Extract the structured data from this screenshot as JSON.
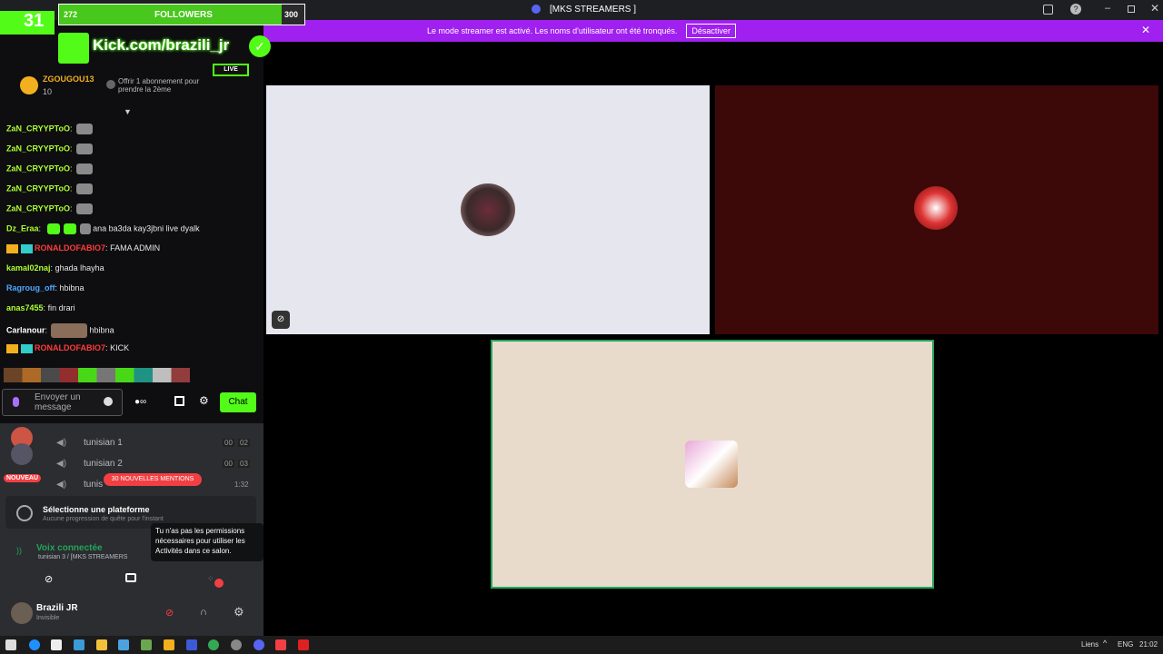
{
  "overlay": {
    "followers_count": "272",
    "followers_label": "FOLLOWERS",
    "followers_goal": "300",
    "kick_url": "Kick.com/brazili_jr",
    "live_badge": "LIVE",
    "counter": "31"
  },
  "window": {
    "title": "[MKS STREAMERS ]"
  },
  "banner": {
    "text": "Le mode streamer est activé. Les noms d'utilisateur ont été tronqués.",
    "button": "Désactiver"
  },
  "chat": {
    "top_user": "ZGOUGOU13",
    "top_count": "10",
    "gift_text": "Offrir 1 abonnement pour prendre la 2ème",
    "messages": [
      {
        "user": "ZaN_CRYYPToO",
        "text": "",
        "color": "#adff2f"
      },
      {
        "user": "ZaN_CRYYPToO",
        "text": "",
        "color": "#adff2f"
      },
      {
        "user": "ZaN_CRYYPToO",
        "text": "",
        "color": "#adff2f"
      },
      {
        "user": "ZaN_CRYYPToO",
        "text": "",
        "color": "#adff2f"
      },
      {
        "user": "ZaN_CRYYPToO",
        "text": "",
        "color": "#adff2f"
      },
      {
        "user": "Dz_Eraa",
        "text": "ana ba3da kay3jbni live dyalk",
        "color": "#adff2f"
      },
      {
        "user": "RONALDOFABIO7",
        "text": "FAMA ADMIN",
        "color": "#ff3b3b"
      },
      {
        "user": "kamal02naj",
        "text": "ghada lhayha",
        "color": "#adff2f"
      },
      {
        "user": "Ragroug_off",
        "text": "hbibna",
        "color": "#4da6ff"
      },
      {
        "user": "anas7455",
        "text": "fin drari",
        "color": "#adff2f"
      },
      {
        "user": "Carlanour",
        "text": "hbibna",
        "color": "#ffffff"
      },
      {
        "user": "RONALDOFABIO7",
        "text": "KICK",
        "color": "#ff3b3b"
      }
    ],
    "input_placeholder": "Envoyer un message",
    "chat_button": "Chat"
  },
  "discord": {
    "channels": [
      {
        "name": "tunisian 1",
        "t1": "00",
        "t2": "02"
      },
      {
        "name": "tunisian 2",
        "t1": "00",
        "t2": "03"
      },
      {
        "name": "tunis",
        "t1": "",
        "t2": "1:32"
      }
    ],
    "nouveau_badge": "NOUVEAU",
    "mentions_badge": "30 NOUVELLES MENTIONS",
    "platform_title": "Sélectionne une plateforme",
    "platform_sub": "Aucune progression de quête pour l'instant",
    "tooltip": "Tu n'as pas les permissions nécessaires pour utiliser les Activités dans ce salon.",
    "voice_status": "Voix connectée",
    "voice_channel": "tunisian 3 / [MKS STREAMERS",
    "user_name": "Brazili JR",
    "user_status": "Invisible"
  },
  "taskbar": {
    "links": "Liens",
    "lang": "ENG",
    "time": "21:02"
  },
  "colors": {
    "banner": "#a020f0",
    "kick_green": "#53fc18",
    "tile1": "#e6e6ee",
    "tile2": "#3d0808",
    "tile3": "#e8dbcc"
  }
}
